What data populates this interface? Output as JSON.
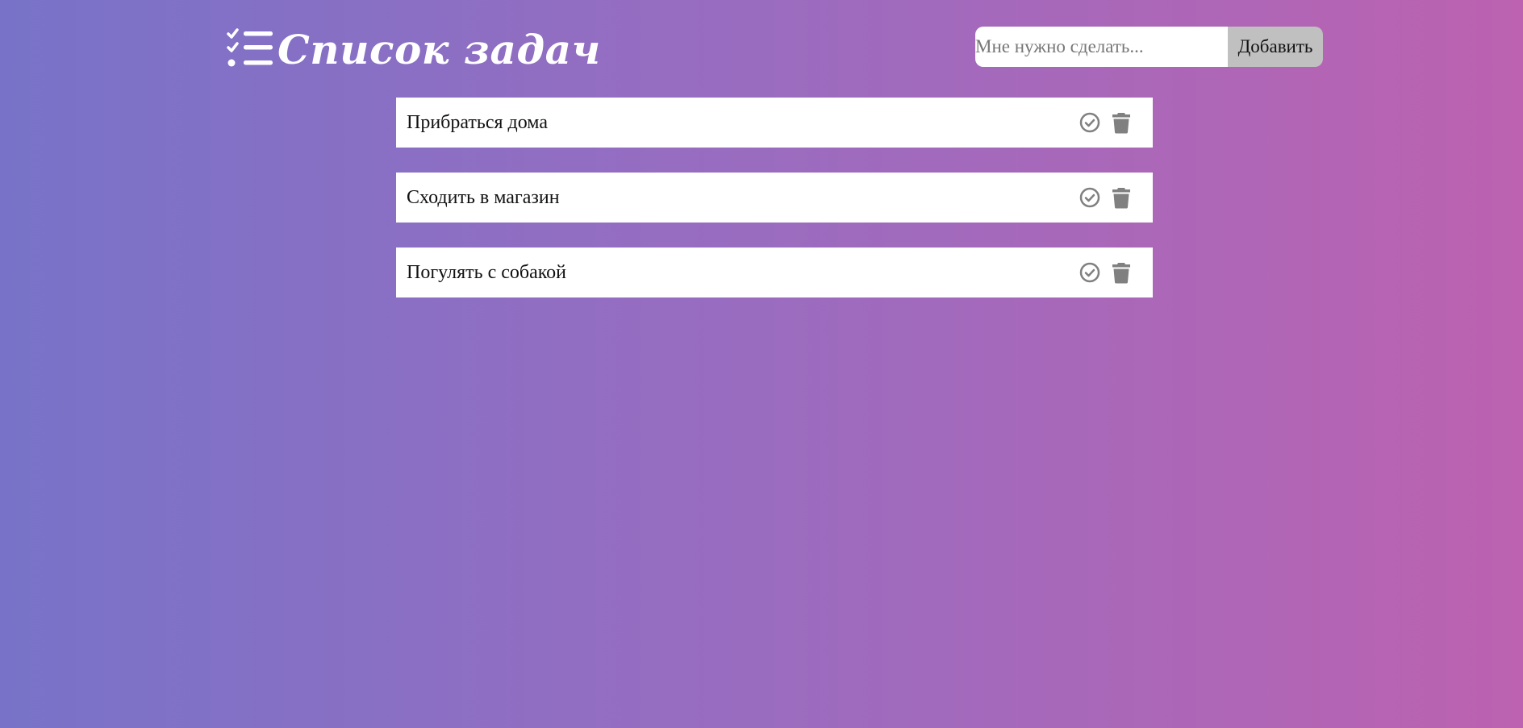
{
  "header": {
    "title": "Список задач",
    "logo_icon": "checklist-icon"
  },
  "form": {
    "input_value": "",
    "input_placeholder": "Мне нужно сделать...",
    "add_label": "Добавить"
  },
  "tasks": [
    {
      "text": "Прибраться дома"
    },
    {
      "text": "Сходить в магазин"
    },
    {
      "text": "Погулять с собакой"
    }
  ],
  "icons": {
    "complete": "check-circle-icon",
    "delete": "trash-icon"
  },
  "colors": {
    "gradient_start": "#7873c8",
    "gradient_end": "#bc62b0",
    "icon": "#808080",
    "button_bg": "#c0c0c0"
  }
}
